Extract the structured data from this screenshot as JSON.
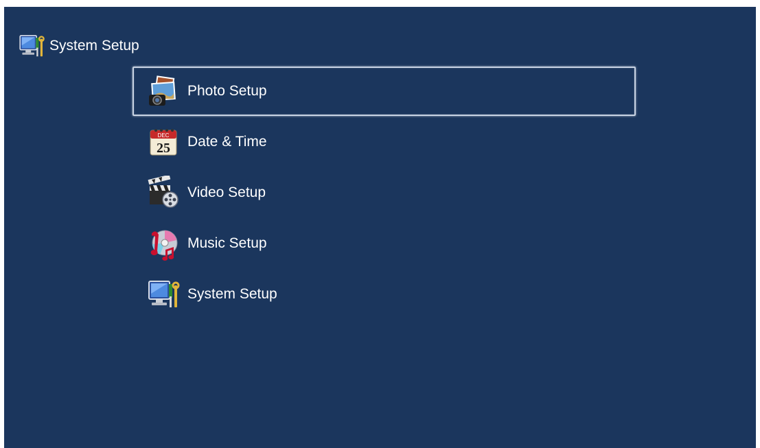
{
  "header": {
    "title": "System Setup",
    "icon": "system-setup-icon"
  },
  "menu": {
    "selected_index": 0,
    "items": [
      {
        "label": "Photo Setup",
        "icon": "photo-setup-icon"
      },
      {
        "label": "Date & Time",
        "icon": "calendar-icon",
        "calendar_day": "25",
        "calendar_month": "DEC"
      },
      {
        "label": "Video Setup",
        "icon": "video-setup-icon"
      },
      {
        "label": "Music Setup",
        "icon": "music-setup-icon"
      },
      {
        "label": "System Setup",
        "icon": "system-setup-icon"
      }
    ]
  },
  "colors": {
    "background": "#1b365d",
    "text": "#ffffff",
    "selection_border": "#c9d4e4"
  }
}
